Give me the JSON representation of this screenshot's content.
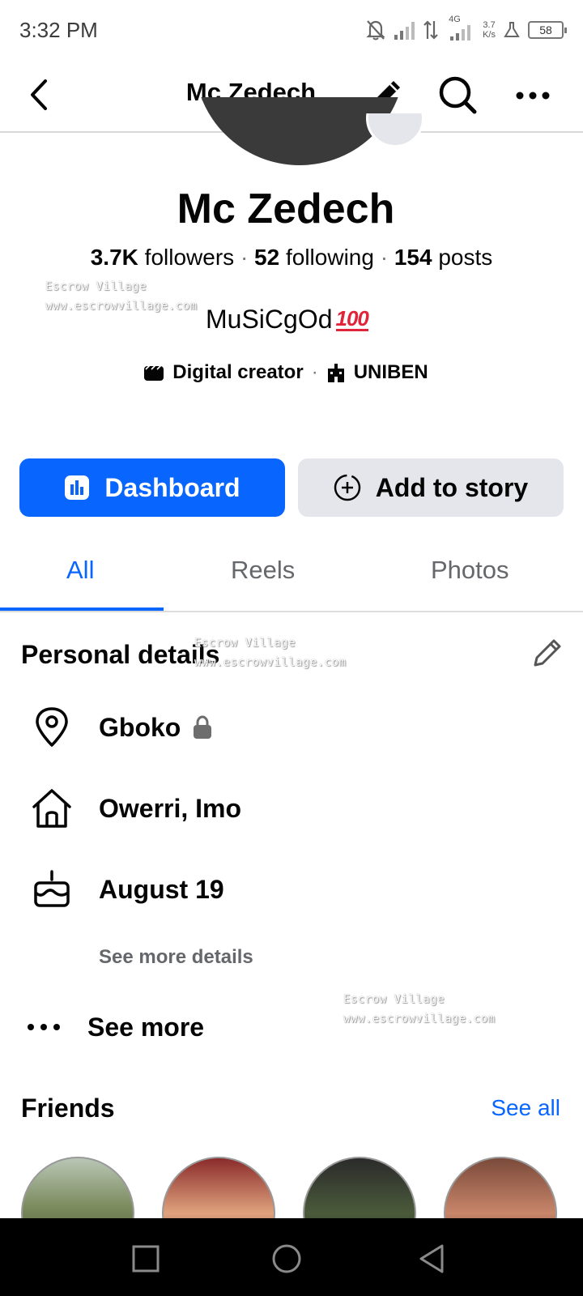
{
  "status_bar": {
    "time": "3:32 PM",
    "network": "4G",
    "speed_value": "3.7",
    "speed_unit": "K/s",
    "battery": "58"
  },
  "top_bar": {
    "title": "Mc Zedech",
    "icons": [
      "back-arrow-icon",
      "pencil-icon",
      "search-icon",
      "more-horizontal-icon"
    ]
  },
  "profile": {
    "name": "Mc Zedech",
    "followers_count": "3.7K",
    "followers_label": "followers",
    "following_count": "52",
    "following_label": "following",
    "posts_count": "154",
    "posts_label": "posts",
    "bio_text": "MuSiCgOd",
    "bio_emoji": "100",
    "category": "Digital creator",
    "school": "UNIBEN"
  },
  "actions": {
    "dashboard_label": "Dashboard",
    "add_story_label": "Add to story",
    "dashboard_color": "#0866ff"
  },
  "tabs": [
    {
      "label": "All",
      "active": true
    },
    {
      "label": "Reels",
      "active": false
    },
    {
      "label": "Photos",
      "active": false
    }
  ],
  "personal_details": {
    "title": "Personal details",
    "location": "Gboko",
    "hometown": "Owerri, Imo",
    "birthday": "August 19",
    "see_more_details": "See more details",
    "see_more": "See more"
  },
  "friends": {
    "title": "Friends",
    "see_all": "See all"
  },
  "watermark": {
    "line1": "Escrow Village",
    "line2": "www.escrowvillage.com"
  }
}
